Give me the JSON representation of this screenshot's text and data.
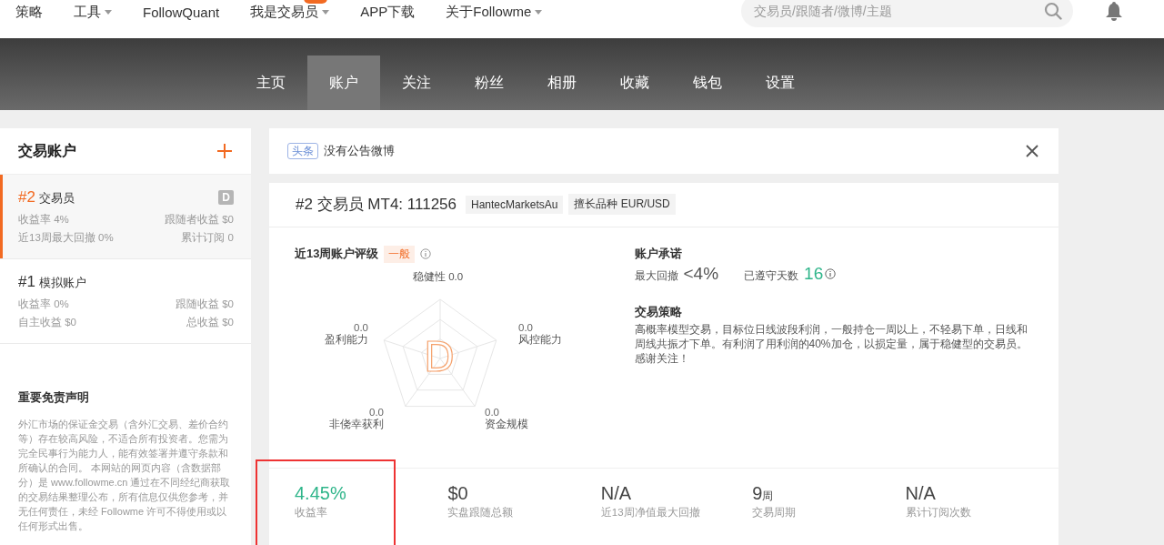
{
  "nav": {
    "items": [
      {
        "label": "策略",
        "dropdown": false,
        "badge": false
      },
      {
        "label": "工具",
        "dropdown": true,
        "badge": false
      },
      {
        "label": "FollowQuant",
        "dropdown": false,
        "badge": false
      },
      {
        "label": "我是交易员",
        "dropdown": true,
        "badge": true
      },
      {
        "label": "APP下载",
        "dropdown": false,
        "badge": false
      },
      {
        "label": "关于Followme",
        "dropdown": true,
        "badge": false
      }
    ],
    "search": {
      "placeholder": "交易员/跟随者/微博/主题"
    }
  },
  "tabs": [
    {
      "label": "主页",
      "selected": false
    },
    {
      "label": "账户",
      "selected": true
    },
    {
      "label": "关注",
      "selected": false
    },
    {
      "label": "粉丝",
      "selected": false
    },
    {
      "label": "相册",
      "selected": false
    },
    {
      "label": "收藏",
      "selected": false
    },
    {
      "label": "钱包",
      "selected": false
    },
    {
      "label": "设置",
      "selected": false
    }
  ],
  "sidebar": {
    "title": "交易账户",
    "accounts": [
      {
        "rank": "#2",
        "name": "交易员",
        "selected": true,
        "grade": "D",
        "stats": [
          "收益率 4%",
          "跟随者收益 $0",
          "近13周最大回撤 0%",
          "累计订阅 0"
        ]
      },
      {
        "rank": "#1",
        "name": "模拟账户",
        "selected": false,
        "stats": [
          "收益率 0%",
          "跟随收益 $0",
          "自主收益 $0",
          "总收益 $0"
        ]
      }
    ],
    "disclaimer": {
      "title": "重要免责声明",
      "text": "外汇市场的保证金交易（含外汇交易、差价合约等）存在较高风险，不适合所有投资者。您需为完全民事行为能力人，能有效签署并遵守条款和所确认的合同。 本网站的网页内容（含数据部分）是 www.followme.cn 通过在不同经纪商获取的交易结果整理公布，所有信息仅供您参考，并无任何责任，未经 Followme 许可不得使用或以任何形式出售。"
    }
  },
  "announcement": {
    "tag": "头条",
    "text": "没有公告微博"
  },
  "account": {
    "title": "#2 交易员 MT4: 111256",
    "tags": [
      "HantecMarketsAu",
      "擅长品种 EUR/USD"
    ],
    "rating": {
      "title": "近13周账户评级",
      "level": "一般",
      "grade": "D",
      "axes": [
        {
          "label": "稳健性",
          "value": "0.0"
        },
        {
          "label": "盈利能力",
          "value": "0.0"
        },
        {
          "label": "风控能力",
          "value": "0.0"
        },
        {
          "label": "非侥幸获利",
          "value": "0.0"
        },
        {
          "label": "资金规模",
          "value": "0.0"
        }
      ]
    },
    "commitment": {
      "title": "账户承诺",
      "items": [
        {
          "kind": "limit",
          "label": "最大回撤",
          "value": "<4%"
        },
        {
          "kind": "days",
          "label": "已遵守天数",
          "value": "16"
        }
      ]
    },
    "strategy": {
      "title": "交易策略",
      "text": "高概率模型交易，目标位日线波段利润，一般持仓一周以上，不轻易下单，日线和周线共振才下单。有利润了用利润的40%加仓，以损定量，属于稳健型的交易员。感谢关注！"
    },
    "stats": [
      {
        "value": "4.45%",
        "label": "收益率",
        "positive": true,
        "annotated": true
      },
      {
        "value": "$0",
        "label": "实盘跟随总额",
        "positive": false,
        "annotated": false
      },
      {
        "value": "N/A",
        "label": "近13周净值最大回撤",
        "positive": false,
        "annotated": false
      },
      {
        "value": "9",
        "unit": "周",
        "label": "交易周期",
        "positive": false,
        "annotated": false
      },
      {
        "value": "N/A",
        "label": "累计订阅次数",
        "positive": false,
        "annotated": false
      }
    ]
  }
}
